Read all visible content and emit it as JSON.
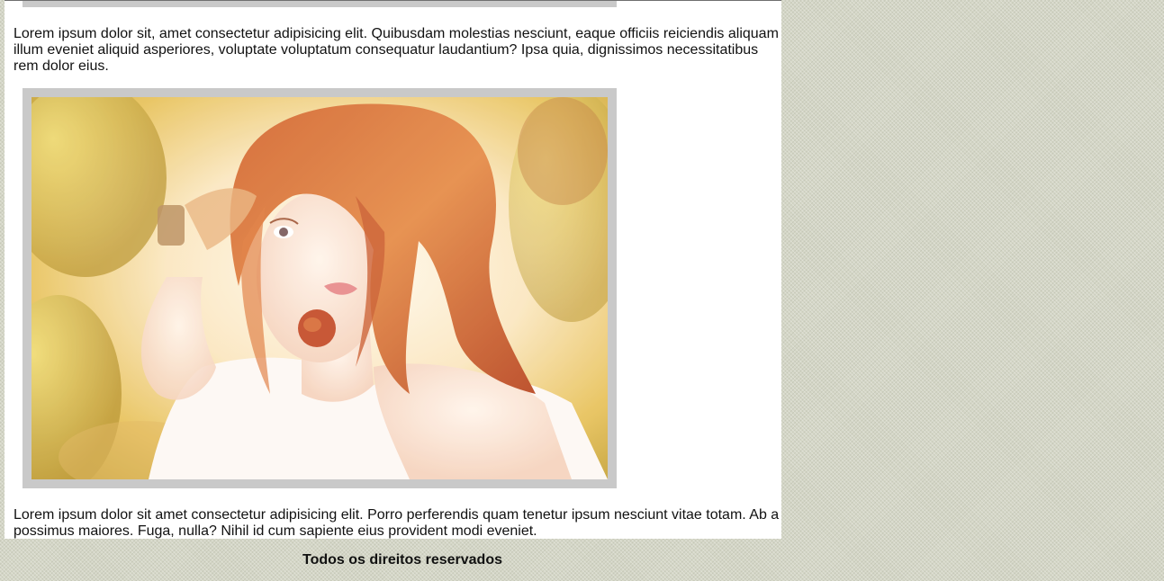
{
  "article": {
    "paragraphs": [
      "Lorem ipsum dolor sit, amet consectetur adipisicing elit. Quibusdam molestias nesciunt, eaque officiis reiciendis aliquam illum eveniet aliquid asperiores, voluptate voluptatum consequatur laudantium? Ipsa quia, dignissimos necessitatibus rem dolor eius.",
      "Lorem ipsum dolor sit amet consectetur adipisicing elit. Porro perferendis quam tenetur ipsum nesciunt vitae totam. Ab a possimus maiores. Fuga, nulla? Nihil id cum sapiente eius provident modi eveniet."
    ],
    "image": {
      "icon": "photo-woman-red-hair",
      "frame_color": "#c9c9c9"
    }
  },
  "footer": {
    "text": "Todos os direitos reservados"
  },
  "colors": {
    "page_background": "#d4d6c6",
    "content_background": "#ffffff",
    "text": "#111111"
  }
}
